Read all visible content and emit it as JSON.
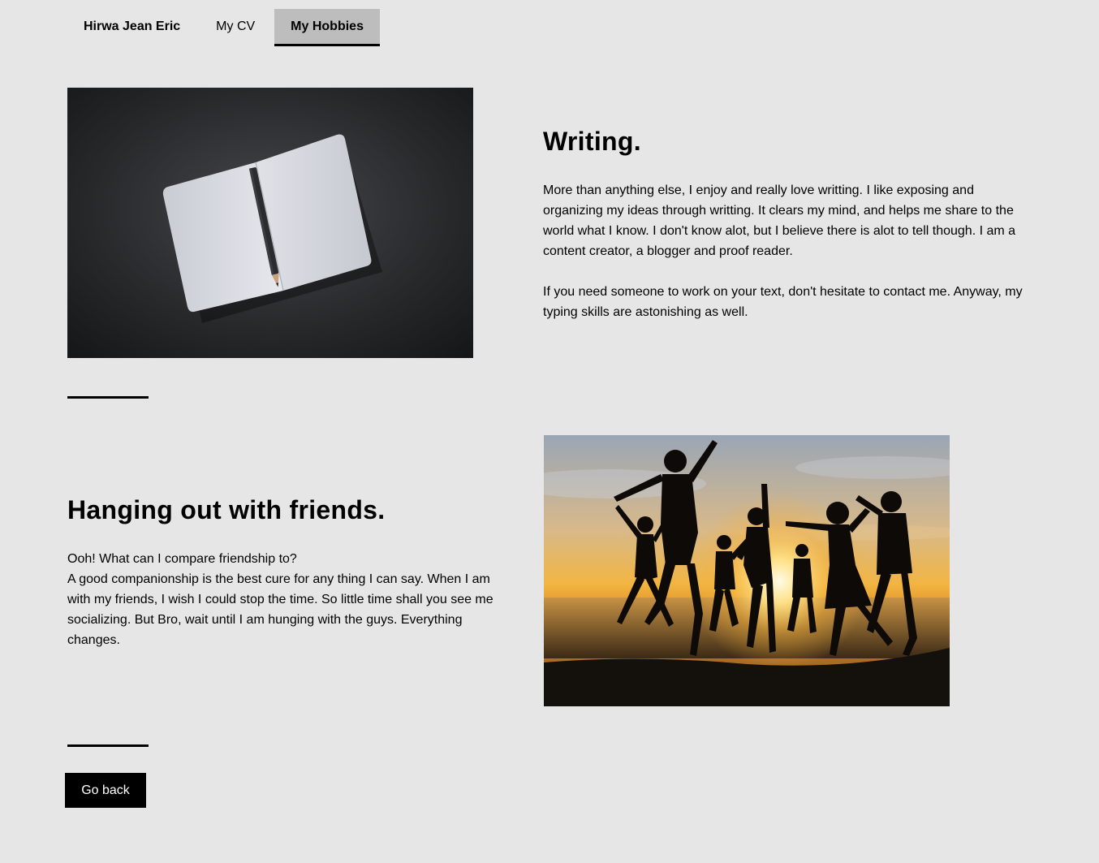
{
  "nav": {
    "brand": "Hirwa Jean Eric",
    "items": [
      {
        "label": "My CV",
        "active": false
      },
      {
        "label": "My Hobbies",
        "active": true
      }
    ]
  },
  "sections": [
    {
      "title": "Writing.",
      "image": "notebook-with-pencil-photo",
      "paragraphs": [
        "More than anything else, I enjoy and really love writting. I like exposing and organizing my ideas through writting. It clears my mind, and helps me share to the world what I know. I don't know alot, but I believe there is alot to tell though. I am a content creator, a blogger and proof reader.",
        "If you need someone to work on your text, don't hesitate to contact me. Anyway, my typing skills are astonishing as well."
      ]
    },
    {
      "title": "Hanging out with friends.",
      "image": "friends-jumping-at-sunset-photo",
      "paragraphs": [
        "Ooh! What can I compare friendship to?",
        "A good companionship is the best cure for any thing I can say. When I am with my friends, I wish I could stop the time. So little time shall you see me socializing. But Bro, wait until I am hunging with the guys. Everything changes."
      ]
    }
  ],
  "buttons": {
    "go_back": "Go back"
  },
  "colors": {
    "background": "#e6e6e6",
    "active_tab": "#bdbdbd",
    "button": "#000000",
    "button_text": "#ffffff"
  }
}
